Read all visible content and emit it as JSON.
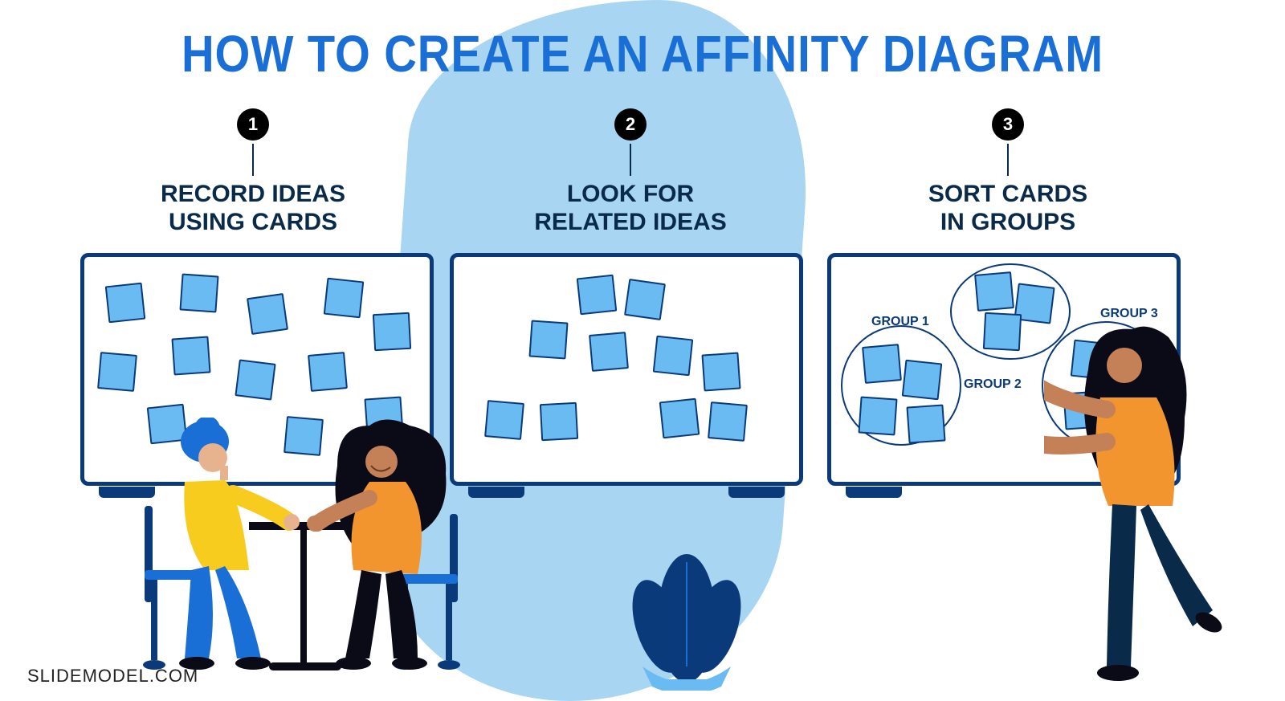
{
  "title": "HOW TO CREATE AN AFFINITY DIAGRAM",
  "footer": "SLIDEMODEL.COM",
  "steps": [
    {
      "num": "1",
      "line1": "RECORD IDEAS",
      "line2": "USING CARDS"
    },
    {
      "num": "2",
      "line1": "LOOK FOR",
      "line2": "RELATED IDEAS"
    },
    {
      "num": "3",
      "line1": "SORT CARDS",
      "line2": "IN GROUPS"
    }
  ],
  "groups": {
    "g1": "GROUP 1",
    "g2": "GROUP 2",
    "g3": "GROUP 3"
  },
  "colors": {
    "title_blue": "#1a6fd6",
    "dark_navy": "#0a2a4a",
    "border_blue": "#0a3a7a",
    "card_fill": "#69bbf2",
    "wave": "#a8d5f2",
    "orange": "#f2952f",
    "yellow": "#f8cc1e",
    "skin1": "#e7b38f",
    "skin2": "#c48056"
  }
}
